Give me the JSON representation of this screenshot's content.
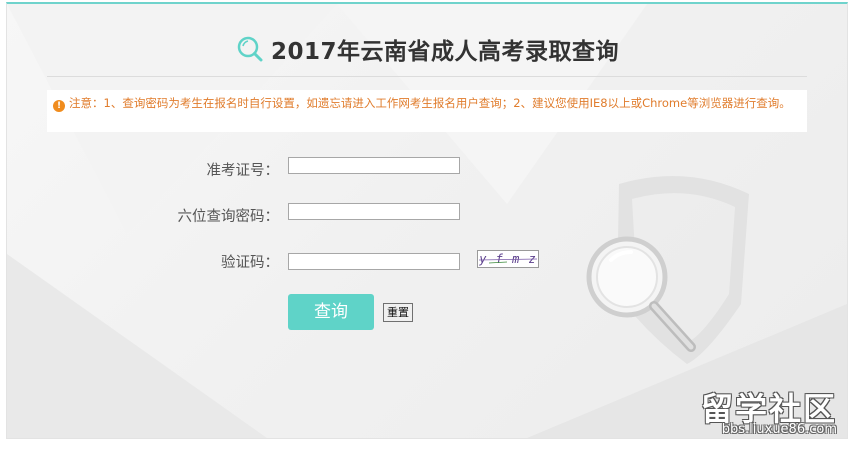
{
  "header": {
    "title": "2017年云南省成人高考录取查询",
    "icon": "search-icon"
  },
  "notice": {
    "icon": "exclamation-icon",
    "text": "注意：1、查询密码为考生在报名时自行设置，如遗忘请进入工作网考生报名用户查询；2、建议您使用IE8以上或Chrome等浏览器进行查询。"
  },
  "form": {
    "admission_label": "准考证号：",
    "admission_value": "",
    "password_label": "六位查询密码：",
    "password_value": "",
    "captcha_label": "验证码：",
    "captcha_value": "",
    "captcha_image_text": "y f m z",
    "query_button": "查询",
    "reset_button": "重置"
  },
  "watermark": {
    "brand": "留学社区",
    "url": "bbs.liuxue86.com"
  },
  "colors": {
    "accent": "#5fd3c8",
    "notice_text": "#e07c2c",
    "notice_icon": "#f08c1e"
  }
}
